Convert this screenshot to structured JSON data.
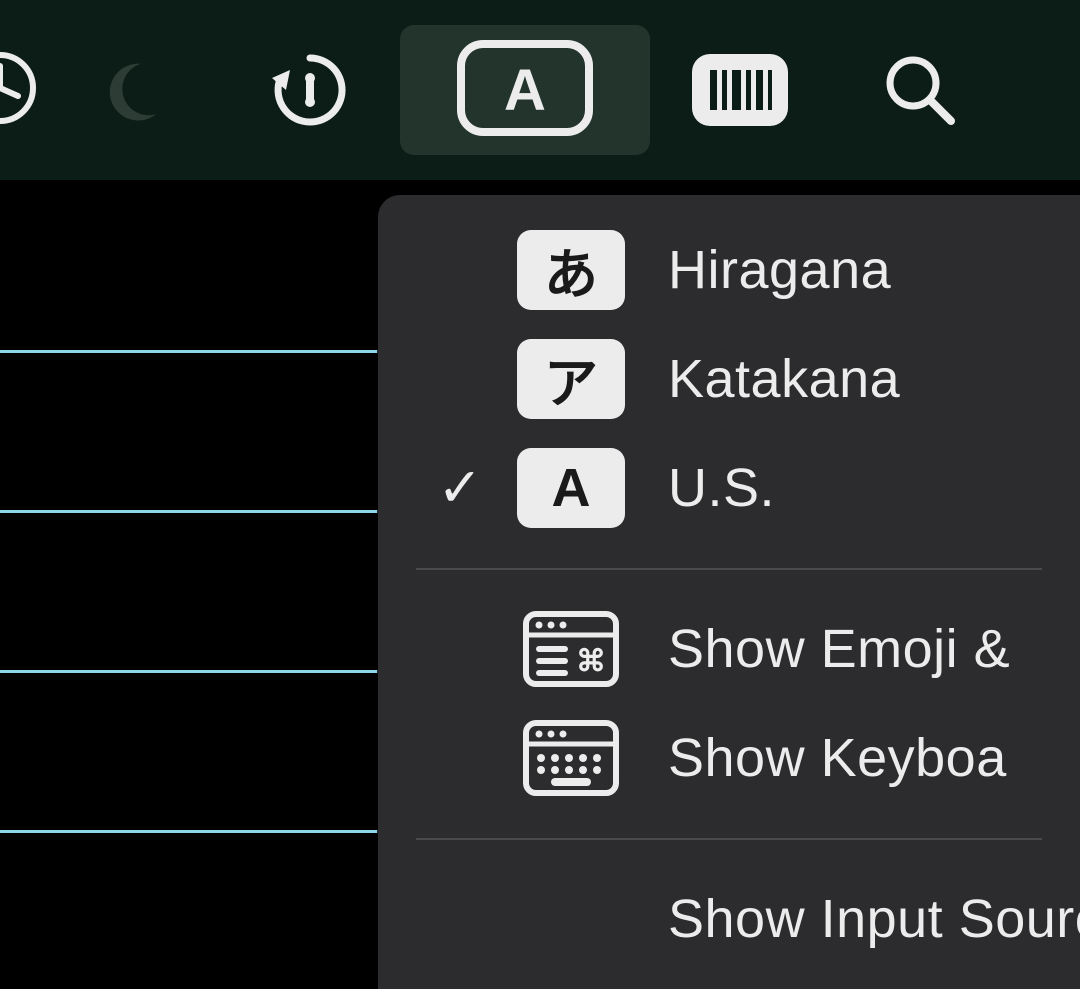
{
  "menubar": {
    "items": [
      {
        "name": "clock-icon"
      },
      {
        "name": "do-not-disturb-icon"
      },
      {
        "name": "time-machine-icon"
      },
      {
        "name": "input-source-icon",
        "glyph": "A",
        "active": true
      },
      {
        "name": "barcode-icon"
      },
      {
        "name": "spotlight-icon"
      }
    ]
  },
  "menu": {
    "inputs": [
      {
        "glyph": "あ",
        "label": "Hiragana",
        "selected": false
      },
      {
        "glyph": "ア",
        "label": "Katakana",
        "selected": false
      },
      {
        "glyph": "A",
        "label": "U.S.",
        "selected": true
      }
    ],
    "viewers": [
      {
        "label": "Show Emoji &"
      },
      {
        "label": "Show Keyboa"
      }
    ],
    "settings": [
      {
        "label": "Show Input Source"
      }
    ]
  }
}
